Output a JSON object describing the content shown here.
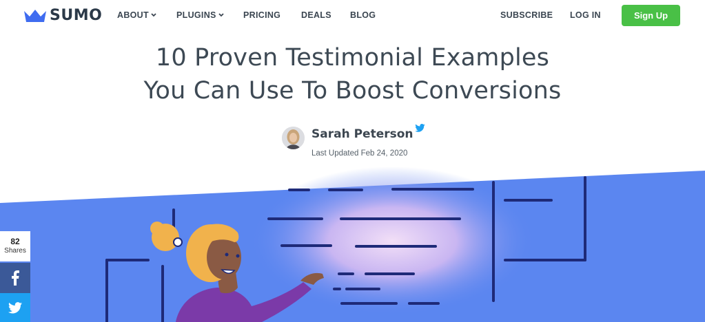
{
  "brand": {
    "name": "SUMO"
  },
  "nav": {
    "left": [
      {
        "label": "ABOUT",
        "dropdown": true
      },
      {
        "label": "PLUGINS",
        "dropdown": true
      },
      {
        "label": "PRICING",
        "dropdown": false
      },
      {
        "label": "DEALS",
        "dropdown": false
      },
      {
        "label": "BLOG",
        "dropdown": false
      }
    ],
    "right": [
      {
        "label": "SUBSCRIBE"
      },
      {
        "label": "LOG IN"
      }
    ],
    "signup_label": "Sign Up"
  },
  "article": {
    "title_line1": "10 Proven Testimonial Examples",
    "title_line2": "You Can Use To Boost Conversions",
    "author": "Sarah Peterson",
    "updated": "Last Updated Feb 24, 2020"
  },
  "share": {
    "count": "82",
    "label": "Shares",
    "icons": [
      "facebook-icon",
      "twitter-icon"
    ]
  },
  "colors": {
    "accent_green": "#49c046",
    "hero_blue": "#5b86f0",
    "brand_blue": "#3f6cf0",
    "facebook": "#3b5998",
    "twitter": "#1da1f2"
  }
}
